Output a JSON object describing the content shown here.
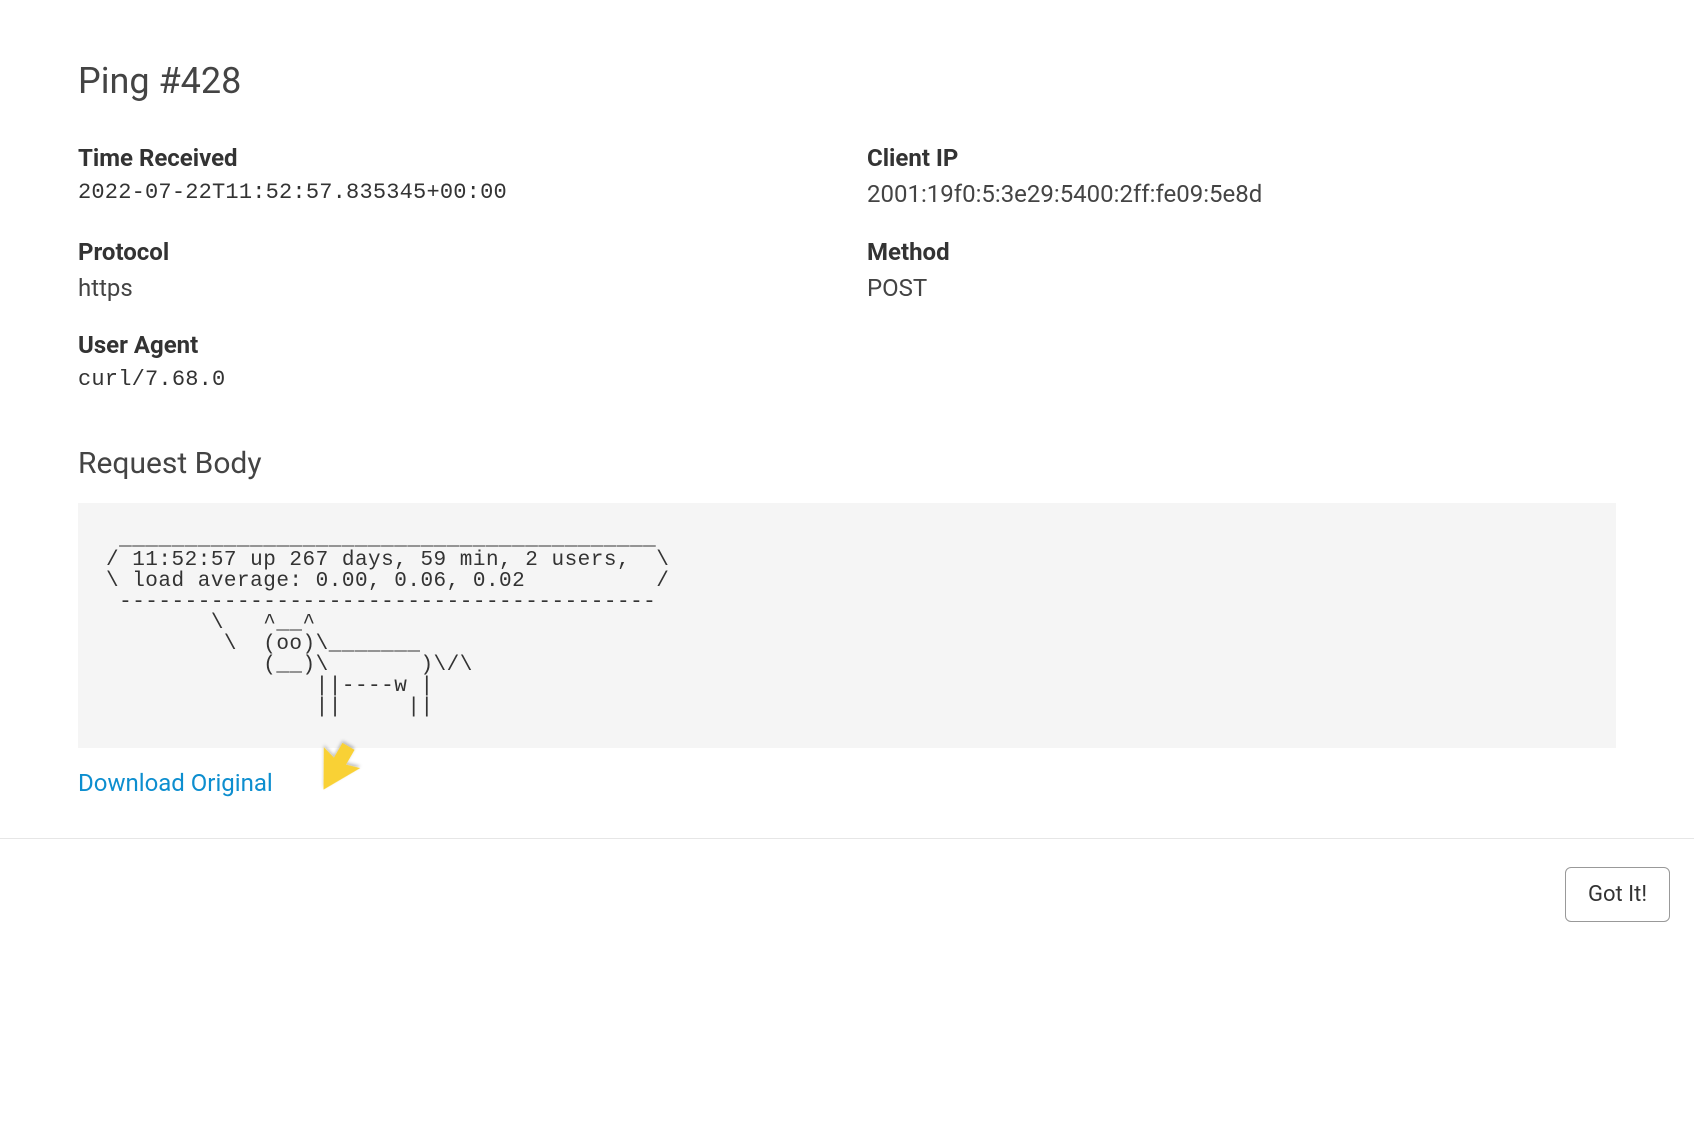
{
  "title": "Ping #428",
  "fields": {
    "time_received": {
      "label": "Time Received",
      "value": "2022-07-22T11:52:57.835345+00:00"
    },
    "client_ip": {
      "label": "Client IP",
      "value": "2001:19f0:5:3e29:5400:2ff:fe09:5e8d"
    },
    "protocol": {
      "label": "Protocol",
      "value": "https"
    },
    "method": {
      "label": "Method",
      "value": "POST"
    },
    "user_agent": {
      "label": "User Agent",
      "value": "curl/7.68.0"
    }
  },
  "request_body": {
    "heading": "Request Body",
    "content": " _________________________________________\n/ 11:52:57 up 267 days, 59 min, 2 users,  \\\n\\ load average: 0.00, 0.06, 0.02          /\n -----------------------------------------\n        \\   ^__^\n         \\  (oo)\\_______\n            (__)\\       )\\/\\\n                ||----w |\n                ||     ||"
  },
  "download_link": "Download Original",
  "got_it_button": "Got It!"
}
